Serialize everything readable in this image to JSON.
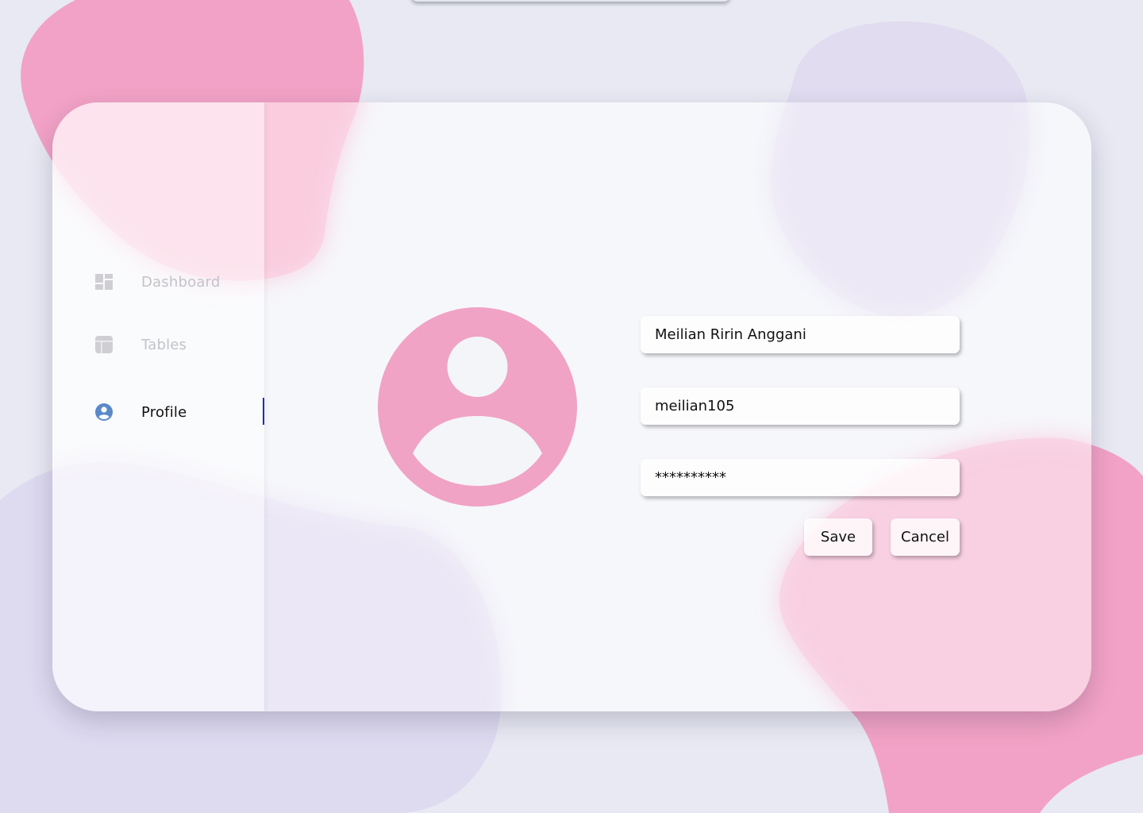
{
  "sidebar": {
    "items": [
      {
        "label": "Dashboard",
        "icon": "dashboard-icon",
        "active": false
      },
      {
        "label": "Tables",
        "icon": "table-icon",
        "active": false
      },
      {
        "label": "Profile",
        "icon": "user-circle-icon",
        "active": true
      }
    ]
  },
  "profile": {
    "avatar_icon": "user-avatar-icon",
    "name_value": "Meilian Ririn Anggani",
    "username_value": "meilian105",
    "password_value": "**********"
  },
  "actions": {
    "save_label": "Save",
    "cancel_label": "Cancel"
  },
  "colors": {
    "background": "#e8e9f3",
    "blob_pink": "#f2a2c6",
    "blob_lavender": "#dedaf0",
    "avatar_pink": "#f0a3c5",
    "profile_icon_blue": "#5a89c8",
    "active_indicator": "#1b2fb5",
    "inactive_text": "#c3c3c8"
  }
}
